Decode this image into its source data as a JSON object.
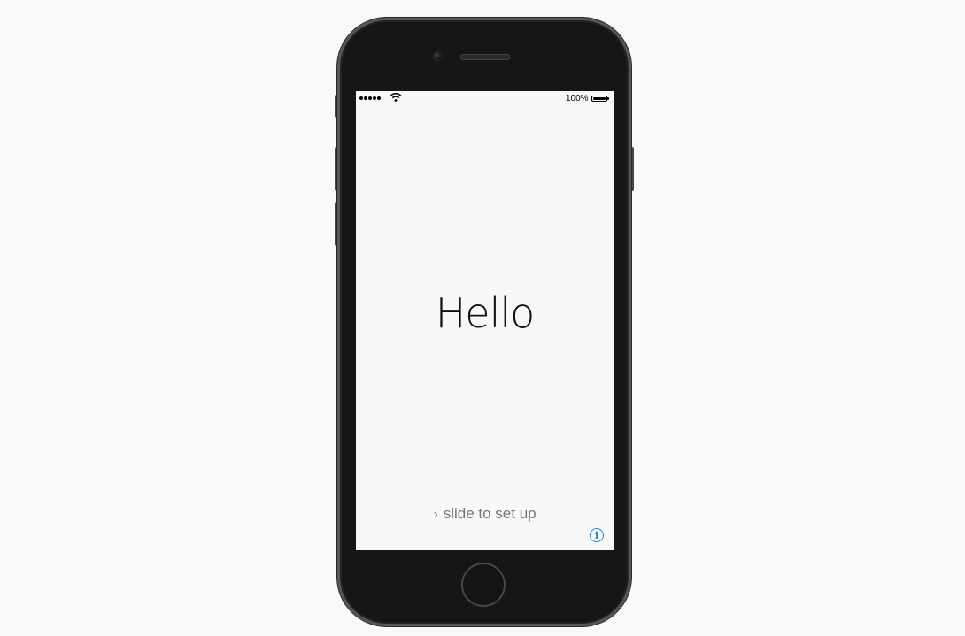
{
  "status_bar": {
    "signal_bars": 5,
    "wifi_icon": "wifi-icon",
    "battery_percent": "100%",
    "battery_icon": "battery-full-icon"
  },
  "screen": {
    "greeting": "Hello",
    "slide_chevron": "›",
    "slide_label": "slide to set up",
    "info_button_symbol": "i"
  },
  "colors": {
    "accent": "#1f86e0",
    "phone_body": "#161616",
    "bezel_edge": "#5a5653",
    "screen_bg": "#f8f8f8"
  }
}
